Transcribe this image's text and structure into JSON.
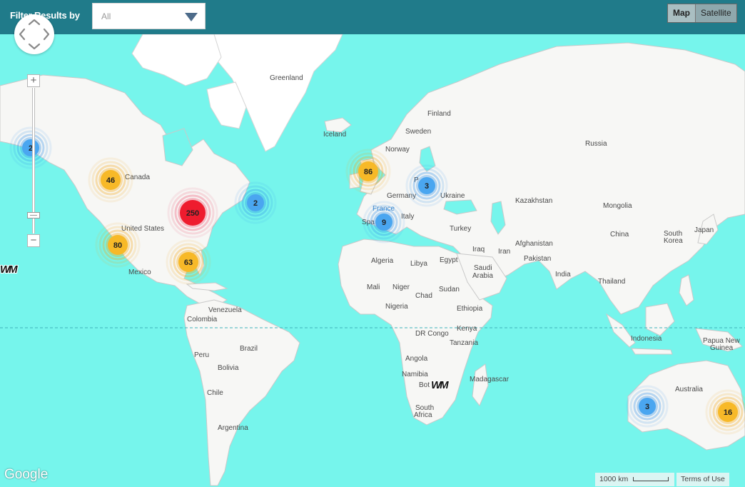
{
  "filter": {
    "label": "Filter Results by",
    "selected": "All"
  },
  "map_type": {
    "map": "Map",
    "satellite": "Satellite",
    "active": "Map"
  },
  "zoom": {
    "in": "+",
    "out": "−"
  },
  "labels": {
    "greenland": "Greenland",
    "iceland": "Iceland",
    "finland": "Finland",
    "sweden": "Sweden",
    "norway": "Norway",
    "russia": "Russia",
    "canada": "Canada",
    "united_states": "United States",
    "mexico": "Mexico",
    "germany": "Germany",
    "ukraine": "Ukraine",
    "poland_partial": "P",
    "france": "France",
    "spain_partial": "Spa",
    "italy": "Italy",
    "kazakhstan": "Kazakhstan",
    "mongolia": "Mongolia",
    "turkey": "Turkey",
    "china": "China",
    "south_korea": "South Korea",
    "japan": "Japan",
    "iraq": "Iraq",
    "iran": "Iran",
    "afghanistan": "Afghanistan",
    "pakistan": "Pakistan",
    "algeria": "Algeria",
    "libya": "Libya",
    "egypt": "Egypt",
    "saudi_arabia": "Saudi Arabia",
    "india": "India",
    "thailand": "Thailand",
    "mali": "Mali",
    "niger": "Niger",
    "chad": "Chad",
    "sudan": "Sudan",
    "nigeria": "Nigeria",
    "ethiopia": "Ethiopia",
    "venezuela": "Venezuela",
    "colombia": "Colombia",
    "kenya": "Kenya",
    "dr_congo": "DR Congo",
    "tanzania": "Tanzania",
    "indonesia": "Indonesia",
    "papua_new_guinea": "Papua New Guinea",
    "brazil": "Brazil",
    "peru": "Peru",
    "bolivia": "Bolivia",
    "angola": "Angola",
    "namibia": "Namibia",
    "botswana_partial": "Bot",
    "madagascar": "Madagascar",
    "chile": "Chile",
    "south_africa": "South Africa",
    "australia": "Australia",
    "argentina": "Argentina"
  },
  "clusters": [
    {
      "id": "alaska",
      "count": "2",
      "level": "blue"
    },
    {
      "id": "west-canada",
      "count": "46",
      "level": "yellow"
    },
    {
      "id": "east-us",
      "count": "250",
      "level": "red"
    },
    {
      "id": "atlantic-canada",
      "count": "2",
      "level": "blue"
    },
    {
      "id": "southwest-us",
      "count": "80",
      "level": "yellow"
    },
    {
      "id": "gulf",
      "count": "63",
      "level": "yellow"
    },
    {
      "id": "uk",
      "count": "86",
      "level": "yellow"
    },
    {
      "id": "central-europe",
      "count": "3",
      "level": "blue"
    },
    {
      "id": "southern-europe",
      "count": "9",
      "level": "blue"
    },
    {
      "id": "west-australia",
      "count": "3",
      "level": "blue"
    },
    {
      "id": "east-australia",
      "count": "16",
      "level": "yellow"
    }
  ],
  "cluster_colors": {
    "blue": {
      "core": "#4aa6f0",
      "halo": "#2f8fe8"
    },
    "yellow": {
      "core": "#f7b928",
      "halo": "#f5a60f"
    },
    "red": {
      "core": "#ee1c2e",
      "halo": "#f04a6a"
    }
  },
  "watermark": "WM",
  "attribution": {
    "google": "Google",
    "scale": "1000 km",
    "terms": "Terms of Use"
  }
}
